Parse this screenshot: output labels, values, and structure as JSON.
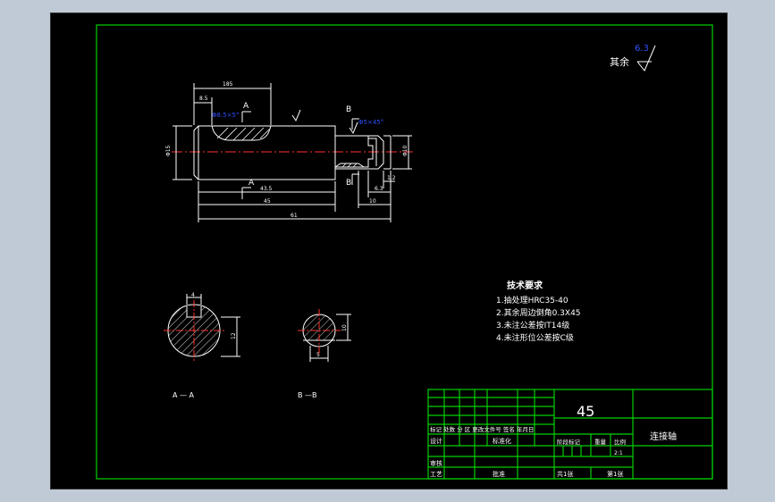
{
  "roughness": {
    "prefix": "其余",
    "value": "6.3"
  },
  "dims": {
    "d_top_overall": "185",
    "d_top_left": "8.5",
    "d_bottom_435": "43.5",
    "d_bottom_45": "45",
    "d_bottom_61": "61",
    "d_right_10": "10",
    "d_right_63": "6.3",
    "d_right_12": "1.2",
    "d_left_dia": "Φ15",
    "d_right_dia": "Φ10",
    "chamfer_a": "Φ8.5×5°",
    "chamfer_b": "Φ5×45°",
    "sec_a_top": "4",
    "sec_a_right": "12",
    "sec_b_bottom": "5",
    "sec_b_right": "10"
  },
  "section_marks": {
    "a": "A",
    "b": "B"
  },
  "sections": {
    "a_label": "A — A",
    "b_label": "B —B"
  },
  "tech": {
    "title": "技术要求",
    "items": [
      "1.抽处理HRC35-40",
      "2.其余周边倒角0.3X45",
      "3.未注公差按IT14级",
      "4.未注形位公差按C级"
    ]
  },
  "title_block": {
    "material": "45",
    "name": "连接轴",
    "row_labels": "标记 处数 分 区 更改文件号 签名 年月日",
    "design": "设计",
    "standardize": "标准化",
    "stage_mark": "阶段标记",
    "weight": "重量",
    "scale": "比例",
    "scale_value": "2:1",
    "review": "审核",
    "process": "工艺",
    "approve": "批准",
    "total": "共1张",
    "sheet": "第1张"
  }
}
